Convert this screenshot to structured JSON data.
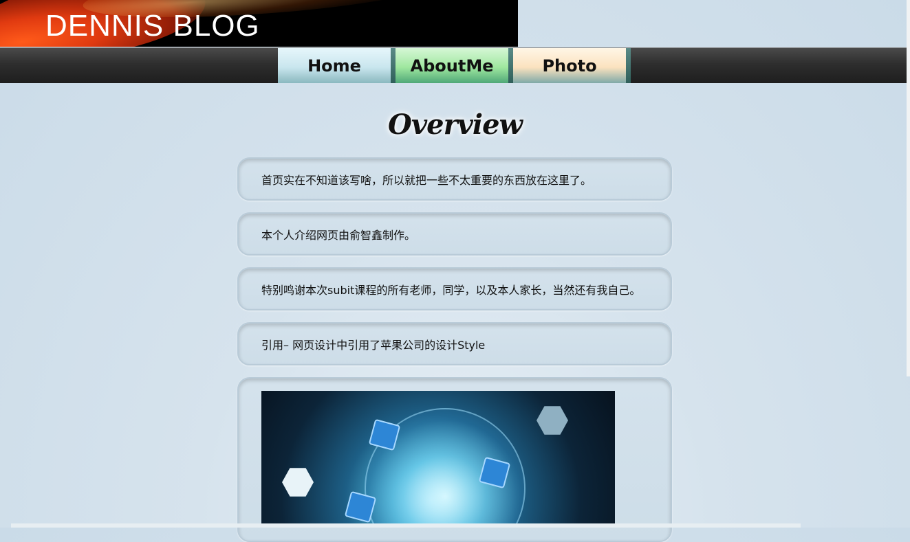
{
  "header": {
    "title": "DENNIS BLOG"
  },
  "nav": {
    "home": "Home",
    "about": "AboutMe",
    "photo": "Photo"
  },
  "main": {
    "heading": "Overview",
    "cards": [
      "首页实在不知道该写啥，所以就把一些不太重要的东西放在这里了。",
      "本个人介绍网页由俞智鑫制作。",
      "特别鸣谢本次subit课程的所有老师，同学，以及本人家长，当然还有我自己。",
      "引用– 网页设计中引用了苹果公司的设计Style"
    ]
  },
  "colors": {
    "background": "#cddde8",
    "navbar": "#2e2e2e",
    "banner": "#000000"
  }
}
